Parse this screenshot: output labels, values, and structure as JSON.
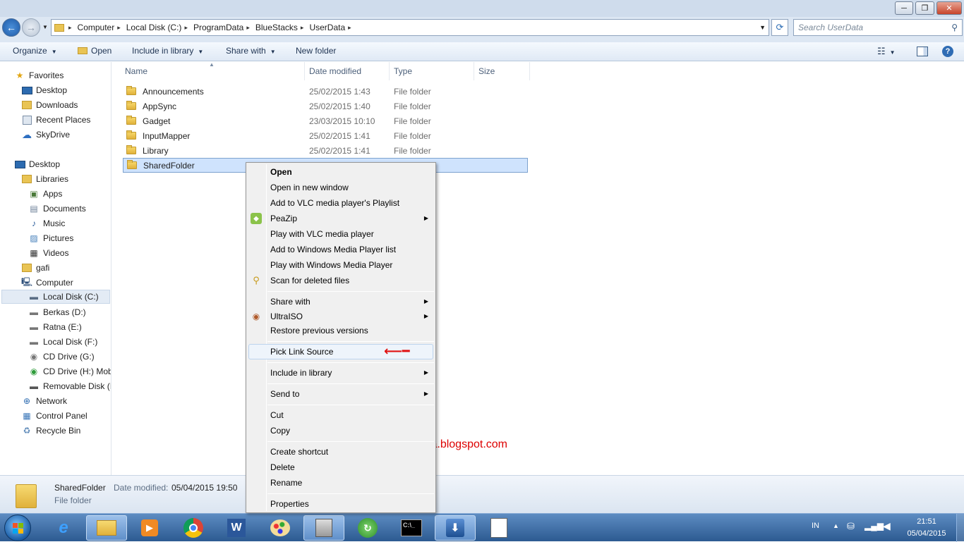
{
  "window": {
    "controls": {
      "minimize": "─",
      "maximize": "❐",
      "close": "✕"
    }
  },
  "nav": {
    "back": "←",
    "forward": "→",
    "breadcrumb": [
      "Computer",
      "Local Disk (C:)",
      "ProgramData",
      "BlueStacks",
      "UserData"
    ],
    "search_placeholder": "Search UserData"
  },
  "toolbar": {
    "organize": "Organize",
    "open": "Open",
    "include_in_library": "Include in library",
    "share_with": "Share with",
    "new_folder": "New folder"
  },
  "sidebar": {
    "favorites_header": "Favorites",
    "favorites": [
      "Desktop",
      "Downloads",
      "Recent Places",
      "SkyDrive"
    ],
    "desktop_header": "Desktop",
    "libraries": "Libraries",
    "library_items": [
      "Apps",
      "Documents",
      "Music",
      "Pictures",
      "Videos"
    ],
    "user": "gafi",
    "computer": "Computer",
    "drives": [
      "Local Disk (C:)",
      "Berkas (D:)",
      "Ratna (E:)",
      "Local Disk (F:)",
      "CD Drive (G:)",
      "CD Drive (H:) Mob",
      "Removable Disk (I:"
    ],
    "network": "Network",
    "control_panel": "Control Panel",
    "recycle_bin": "Recycle Bin"
  },
  "columns": {
    "name": "Name",
    "date": "Date modified",
    "type": "Type",
    "size": "Size"
  },
  "files": [
    {
      "name": "Announcements",
      "date": "25/02/2015 1:43",
      "type": "File folder"
    },
    {
      "name": "AppSync",
      "date": "25/02/2015 1:40",
      "type": "File folder"
    },
    {
      "name": "Gadget",
      "date": "23/03/2015 10:10",
      "type": "File folder"
    },
    {
      "name": "InputMapper",
      "date": "25/02/2015 1:41",
      "type": "File folder"
    },
    {
      "name": "Library",
      "date": "25/02/2015 1:41",
      "type": "File folder"
    },
    {
      "name": "SharedFolder",
      "date": "",
      "type": ""
    }
  ],
  "context_menu": {
    "open": "Open",
    "open_new_window": "Open in new window",
    "add_vlc_playlist": "Add to VLC media player's Playlist",
    "peazip": "PeaZip",
    "play_vlc": "Play with VLC media player",
    "add_wmp_list": "Add to Windows Media Player list",
    "play_wmp": "Play with Windows Media Player",
    "scan_deleted": "Scan for deleted files",
    "share_with": "Share with",
    "ultraiso": "UltraISO",
    "restore_versions": "Restore previous versions",
    "pick_link_source": "Pick Link Source",
    "include_in_library": "Include in library",
    "send_to": "Send to",
    "cut": "Cut",
    "copy": "Copy",
    "create_shortcut": "Create shortcut",
    "delete": "Delete",
    "rename": "Rename",
    "properties": "Properties"
  },
  "watermark": "http://mumulala.blogspot.com",
  "details": {
    "name": "SharedFolder",
    "date_label": "Date modified:",
    "date_value": "05/04/2015 19:50",
    "type": "File folder"
  },
  "taskbar": {
    "lang": "IN",
    "time": "21:51",
    "date": "05/04/2015"
  },
  "colors": {
    "accent_red": "#dd0000",
    "selection": "#cfe3fd",
    "taskbar": "#2c5a91"
  }
}
